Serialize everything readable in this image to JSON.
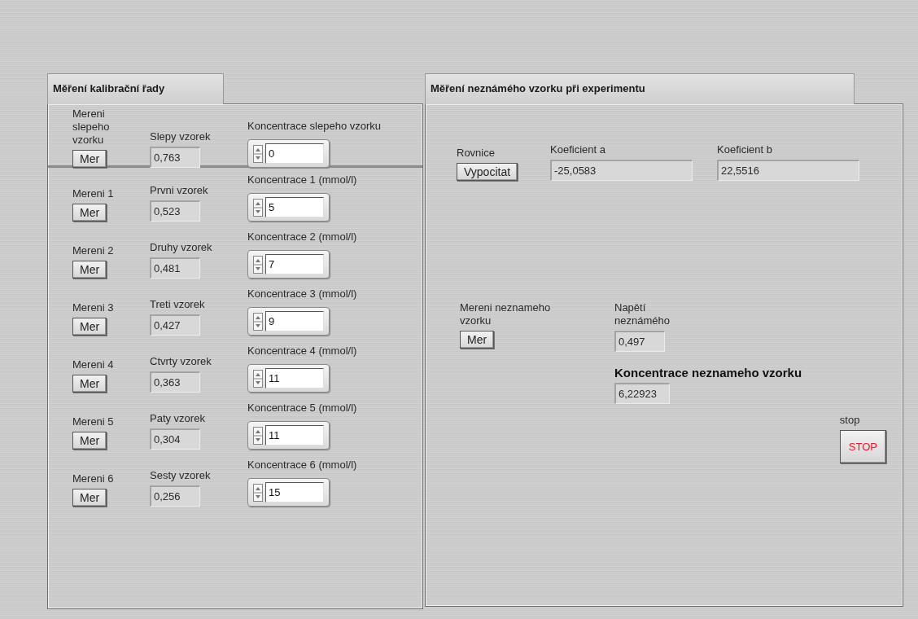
{
  "left_panel": {
    "title": "Měření kalibrační řady",
    "blank": {
      "button_label": "Mereni slepeho vzorku",
      "button": "Mer",
      "indicator_label": "Slepy vzorek",
      "indicator_value": "0,763",
      "control_label": "Koncentrace slepeho vzorku",
      "control_value": "0"
    },
    "rows": [
      {
        "button_label": "Mereni 1",
        "button": "Mer",
        "indicator_label": "Prvni vzorek",
        "indicator_value": "0,523",
        "control_label": "Koncentrace 1 (mmol/l)",
        "control_value": "5"
      },
      {
        "button_label": "Mereni 2",
        "button": "Mer",
        "indicator_label": "Druhy vzorek",
        "indicator_value": "0,481",
        "control_label": "Koncentrace 2 (mmol/l)",
        "control_value": "7"
      },
      {
        "button_label": "Mereni 3",
        "button": "Mer",
        "indicator_label": "Treti vzorek",
        "indicator_value": "0,427",
        "control_label": "Koncentrace 3 (mmol/l)",
        "control_value": "9"
      },
      {
        "button_label": "Mereni 4",
        "button": "Mer",
        "indicator_label": "Ctvrty vzorek",
        "indicator_value": "0,363",
        "control_label": "Koncentrace 4 (mmol/l)",
        "control_value": "11"
      },
      {
        "button_label": "Mereni 5",
        "button": "Mer",
        "indicator_label": "Paty vzorek",
        "indicator_value": "0,304",
        "control_label": "Koncentrace 5 (mmol/l)",
        "control_value": "11"
      },
      {
        "button_label": "Mereni 6",
        "button": "Mer",
        "indicator_label": "Sesty vzorek",
        "indicator_value": "0,256",
        "control_label": "Koncentrace 6 (mmol/l)",
        "control_value": "15"
      }
    ]
  },
  "right_panel": {
    "title": "Měření neznámého vzorku při experimentu",
    "equation": {
      "label": "Rovnice",
      "button": "Vypocitat"
    },
    "coefficients": [
      {
        "label": "Koeficient a",
        "value": "-25,0583"
      },
      {
        "label": "Koeficient b",
        "value": "22,5516"
      }
    ],
    "unknown": {
      "label": "Mereni neznameho vzorku",
      "button": "Mer",
      "voltage_label": "Napětí neznámého",
      "voltage_value": "0,497",
      "result_label": "Koncentrace neznameho vzorku",
      "result_value": "6,22923"
    },
    "stop": {
      "label": "stop",
      "button": "STOP"
    }
  }
}
